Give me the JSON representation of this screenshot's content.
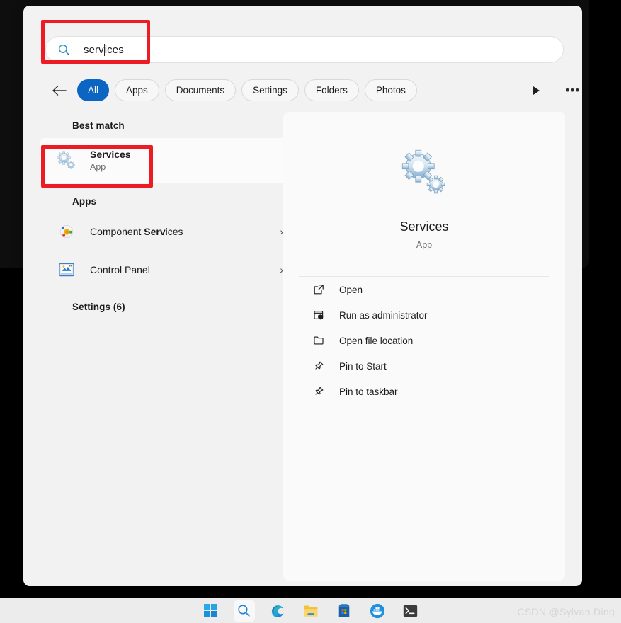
{
  "search": {
    "value_before_caret": "serv",
    "value_after_caret": "ices",
    "full_value": "services",
    "icon": "search-icon"
  },
  "filters": {
    "back_icon": "back-arrow-icon",
    "chips": [
      {
        "label": "All",
        "active": true
      },
      {
        "label": "Apps",
        "active": false
      },
      {
        "label": "Documents",
        "active": false
      },
      {
        "label": "Settings",
        "active": false
      },
      {
        "label": "Folders",
        "active": false
      },
      {
        "label": "Photos",
        "active": false
      }
    ],
    "play_icon": "play-triangle-icon",
    "more_label": "•••"
  },
  "results": {
    "best_match_header": "Best match",
    "best_match": {
      "title": "Services",
      "subtitle": "App",
      "icon": "gears-icon"
    },
    "apps_header": "Apps",
    "apps": [
      {
        "title_prefix": "Component ",
        "title_bold": "Serv",
        "title_suffix": "ices",
        "icon": "component-services-icon",
        "chevron": "›"
      },
      {
        "title_prefix": "Control Panel",
        "title_bold": "",
        "title_suffix": "",
        "icon": "control-panel-icon",
        "chevron": "›"
      }
    ],
    "settings_header": "Settings (6)"
  },
  "preview": {
    "icon": "gears-icon",
    "title": "Services",
    "subtitle": "App",
    "actions": [
      {
        "label": "Open",
        "icon": "open-external-icon"
      },
      {
        "label": "Run as administrator",
        "icon": "shield-window-icon"
      },
      {
        "label": "Open file location",
        "icon": "folder-icon"
      },
      {
        "label": "Pin to Start",
        "icon": "pin-icon"
      },
      {
        "label": "Pin to taskbar",
        "icon": "pin-icon"
      }
    ]
  },
  "taskbar": {
    "items": [
      {
        "name": "start-button",
        "icon": "windows-logo-icon",
        "selected": false
      },
      {
        "name": "search-button",
        "icon": "search-icon",
        "selected": true
      },
      {
        "name": "edge-button",
        "icon": "edge-icon",
        "selected": false
      },
      {
        "name": "file-explorer-button",
        "icon": "folder-icon",
        "selected": false
      },
      {
        "name": "microsoft-store-button",
        "icon": "store-icon",
        "selected": false
      },
      {
        "name": "docker-button",
        "icon": "docker-icon",
        "selected": false
      },
      {
        "name": "terminal-button",
        "icon": "terminal-icon",
        "selected": false
      }
    ]
  },
  "watermark": {
    "text": "CSDN @Sylvan Ding"
  },
  "colors": {
    "accent": "#0a66c2",
    "annotation": "#ed1c24",
    "panel_bg": "#f2f2f2",
    "taskbar_bg": "#ececec"
  }
}
